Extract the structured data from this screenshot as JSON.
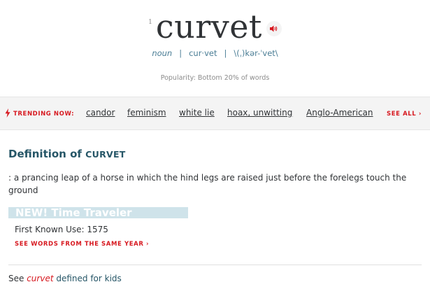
{
  "entry": {
    "homograph_number": "1",
    "headword": "curvet",
    "part_of_speech": "noun",
    "syllables": "cur·vet",
    "pronunciation": "\\(ˌ)kər-ˈvet\\",
    "separator": "|",
    "popularity": "Popularity: Bottom 20% of words"
  },
  "trending": {
    "label": "TRENDING NOW:",
    "items": [
      "candor",
      "feminism",
      "white lie",
      "hoax, unwitting",
      "Anglo-American"
    ],
    "see_all": "SEE ALL ›"
  },
  "definition": {
    "heading_prefix": "Definition of ",
    "heading_word": "CURVET",
    "text": ": a prancing leap of a horse in which the hind legs are raised just before the forelegs touch the ground"
  },
  "time_traveler": {
    "label": "NEW! Time Traveler",
    "first_known_use": "First Known Use: 1575",
    "same_year_link": "SEE WORDS FROM THE SAME YEAR ›"
  },
  "kids": {
    "prefix": "See ",
    "word": "curvet",
    "suffix": " defined for kids"
  },
  "colors": {
    "accent_red": "#d71920",
    "heading_blue": "#265667",
    "meta_blue": "#4a7d95",
    "time_traveler_bar": "#cfe3ea"
  },
  "icons": {
    "audio": "speaker-icon",
    "trending": "lightning-bolt-icon"
  }
}
